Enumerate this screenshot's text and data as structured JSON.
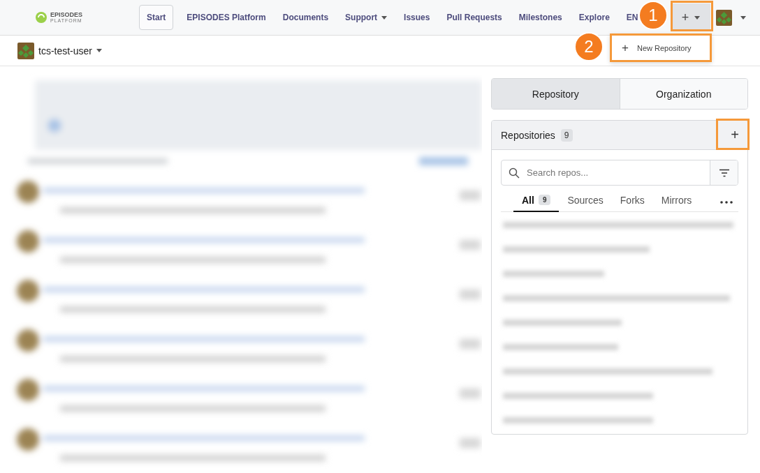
{
  "navbar": {
    "logo": {
      "line1": "EPISODES",
      "line2": "PLATFORM"
    },
    "items": [
      {
        "label": "Start",
        "selected": true,
        "dropdown": false
      },
      {
        "label": "EPISODES Platform",
        "selected": false,
        "dropdown": false
      },
      {
        "label": "Documents",
        "selected": false,
        "dropdown": false
      },
      {
        "label": "Support",
        "selected": false,
        "dropdown": true
      },
      {
        "label": "Issues",
        "selected": false,
        "dropdown": false
      },
      {
        "label": "Pull Requests",
        "selected": false,
        "dropdown": false
      },
      {
        "label": "Milestones",
        "selected": false,
        "dropdown": false
      },
      {
        "label": "Explore",
        "selected": false,
        "dropdown": false
      },
      {
        "label": "EN",
        "selected": false,
        "dropdown": false
      }
    ],
    "create_button": {
      "label": "+",
      "expanded": true
    },
    "create_menu": {
      "items": [
        {
          "icon": "+",
          "label": "New Repository"
        }
      ]
    }
  },
  "callouts": [
    {
      "number": "1"
    },
    {
      "number": "2"
    }
  ],
  "context": {
    "user": "tcs-test-user"
  },
  "dashboard_tabs": [
    {
      "label": "Repository",
      "selected": true
    },
    {
      "label": "Organization",
      "selected": false
    }
  ],
  "repositories": {
    "title": "Repositories",
    "count": "9",
    "add_button": "+",
    "search": {
      "placeholder": "Search repos..."
    },
    "filters": [
      {
        "label": "All",
        "count": "9",
        "selected": true
      },
      {
        "label": "Sources",
        "selected": false
      },
      {
        "label": "Forks",
        "selected": false
      },
      {
        "label": "Mirrors",
        "selected": false
      }
    ]
  }
}
